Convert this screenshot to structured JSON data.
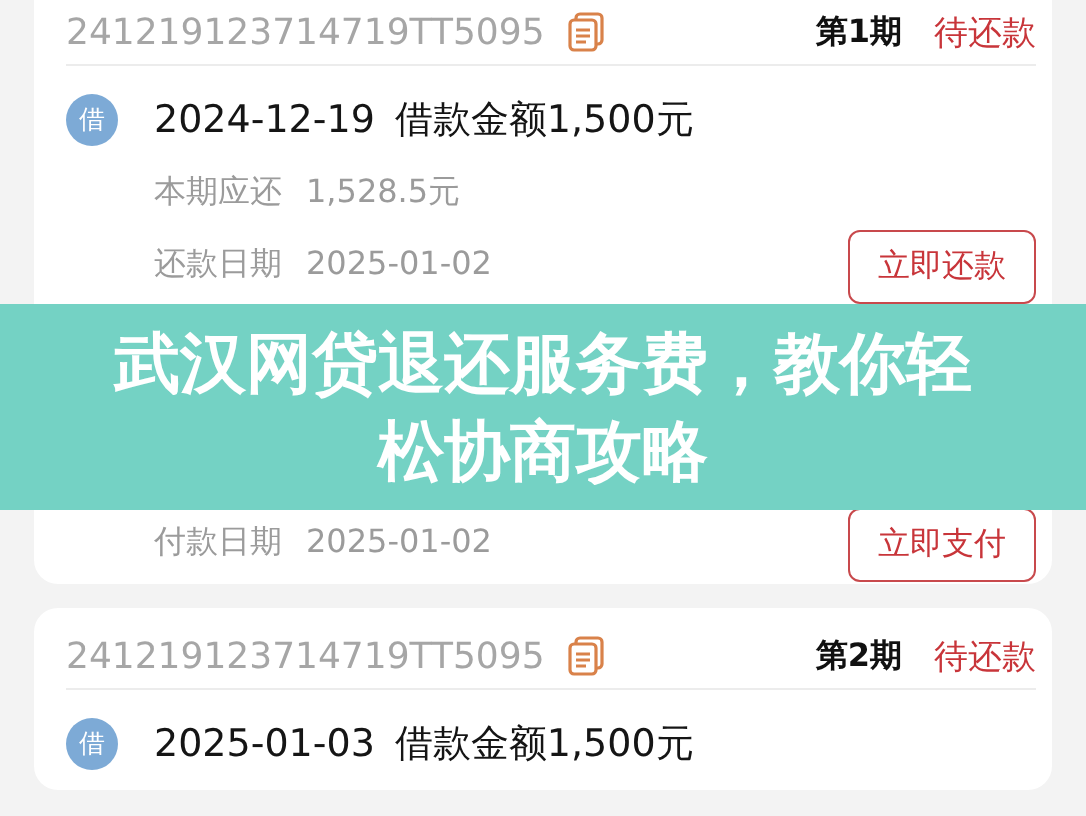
{
  "cards": [
    {
      "order_no": "241219123714719TT5095",
      "period": "第1期",
      "status": "待还款",
      "items": [
        {
          "badge": "借",
          "color": "#7daad6",
          "date": "2024-12-19",
          "title": "借款金额1,500元",
          "due_label": "本期应还",
          "due_value": "1,528.5元",
          "pay_label": "还款日期",
          "pay_value": "2025-01-02",
          "button": "立即还款"
        },
        {
          "pay_label": "付款日期",
          "pay_value": "2025-01-02",
          "button": "立即支付"
        }
      ]
    },
    {
      "order_no": "241219123714719TT5095",
      "period": "第2期",
      "status": "待还款",
      "items": [
        {
          "badge": "借",
          "color": "#7daad6",
          "date": "2025-01-03",
          "title": "借款金额1,500元"
        }
      ]
    }
  ],
  "banner": {
    "title": "武汉网贷退还服务费，教你轻松协商攻略"
  }
}
